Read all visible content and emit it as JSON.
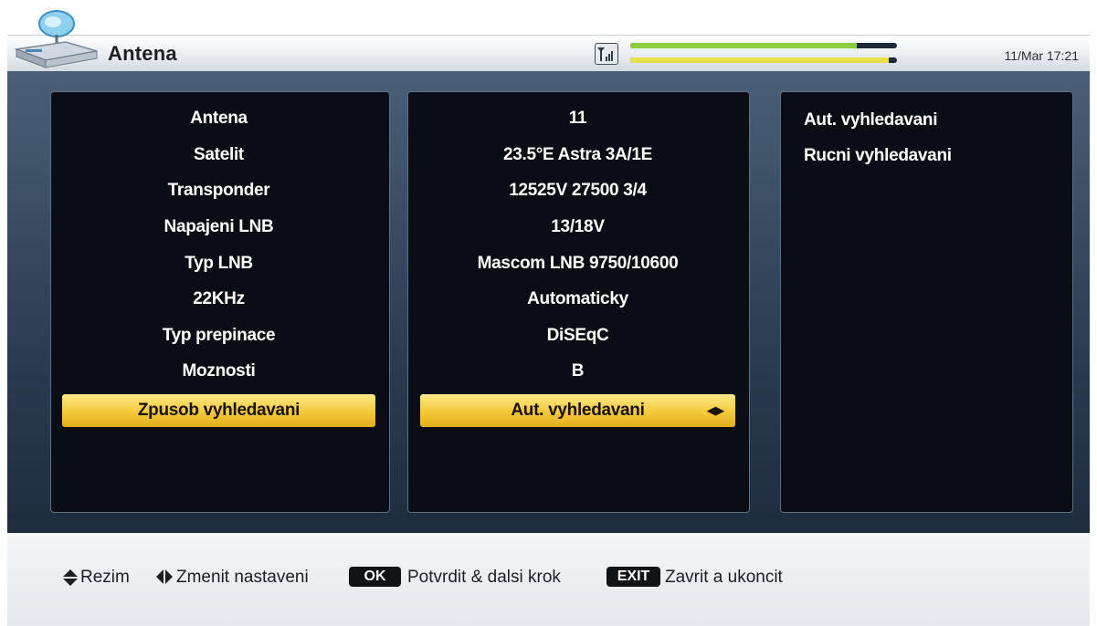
{
  "header": {
    "title": "Antena",
    "datetime": "11/Mar 17:21",
    "signal_strength": 0.85,
    "signal_quality": 0.97,
    "signal_icon": "antenna-signal-icon",
    "logo_icon": "satellite-dish-icon"
  },
  "settings": {
    "labels": [
      "Antena",
      "Satelit",
      "Transponder",
      "Napajeni LNB",
      "Typ LNB",
      "22KHz",
      "Typ prepinace",
      "Moznosti",
      "Zpusob vyhledavani"
    ],
    "values": [
      "11",
      "23.5°E Astra 3A/1E",
      "12525V 27500 3/4",
      "13/18V",
      "Mascom LNB 9750/10600",
      "Automaticky",
      "DiSEqC",
      "B",
      "Aut. vyhledavani"
    ],
    "selected_index": 8
  },
  "options": {
    "items": [
      "Aut. vyhledavani",
      "Rucni vyhledavani"
    ]
  },
  "footer": {
    "mode_label": "Rezim",
    "change_label": "Zmenit nastaveni",
    "ok_key": "OK",
    "ok_label": "Potvrdit & dalsi krok",
    "exit_key": "EXIT",
    "exit_label": "Zavrit a ukoncit",
    "up_down_icon": "up-down-arrows-icon",
    "left_right_icon": "left-right-arrows-icon"
  },
  "colors": {
    "highlight": "#f4c93a",
    "strength_bar": "#8ccf3e",
    "quality_bar": "#e8e04a",
    "panel_bg": "#0a0e14"
  }
}
